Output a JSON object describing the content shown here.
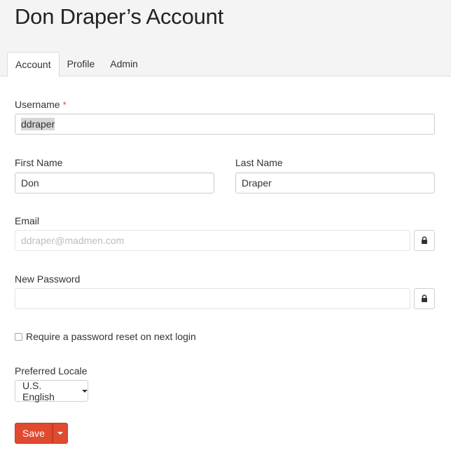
{
  "header": {
    "title": "Don Draper’s Account"
  },
  "tabs": [
    {
      "label": "Account",
      "active": true
    },
    {
      "label": "Profile",
      "active": false
    },
    {
      "label": "Admin",
      "active": false
    }
  ],
  "form": {
    "username": {
      "label": "Username",
      "required_mark": "*",
      "value": "ddraper"
    },
    "first_name": {
      "label": "First Name",
      "value": "Don"
    },
    "last_name": {
      "label": "Last Name",
      "value": "Draper"
    },
    "email": {
      "label": "Email",
      "placeholder": "ddraper@madmen.com",
      "lock_icon": "lock-icon"
    },
    "new_password": {
      "label": "New Password",
      "value": "",
      "lock_icon": "lock-icon"
    },
    "reset_checkbox": {
      "label": "Require a password reset on next login",
      "checked": false
    },
    "locale": {
      "label": "Preferred Locale",
      "selected": "U.S. English"
    }
  },
  "actions": {
    "save_label": "Save"
  },
  "colors": {
    "accent": "#e04a2f",
    "header_bg": "#f4f4f4"
  }
}
